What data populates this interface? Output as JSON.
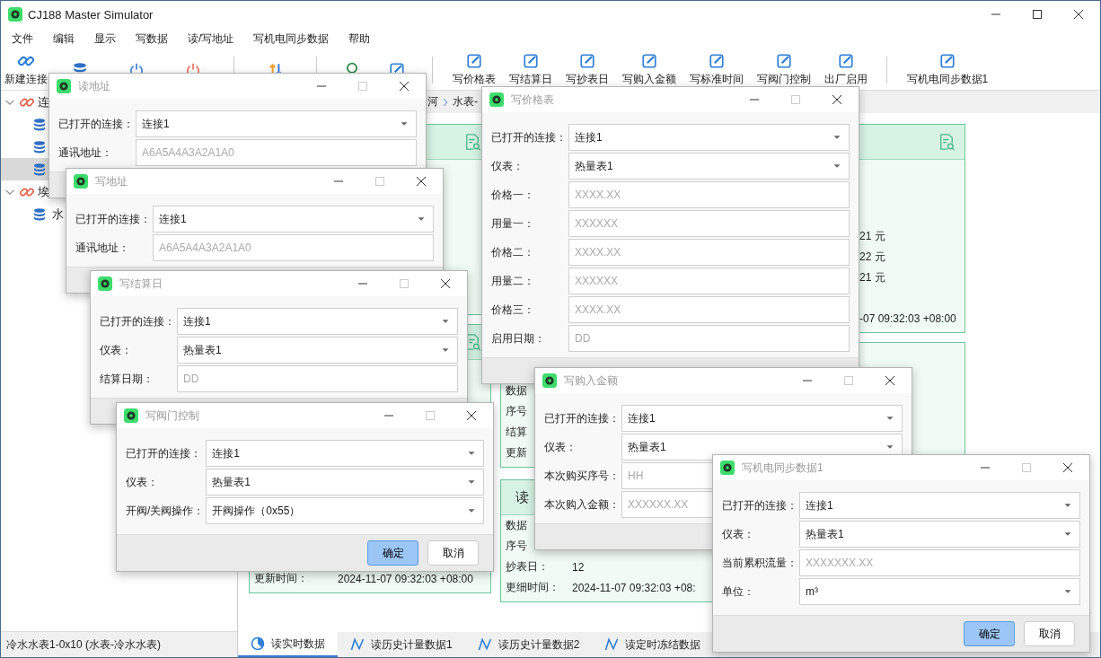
{
  "window": {
    "title": "CJ188 Master Simulator"
  },
  "menu": [
    "文件",
    "编辑",
    "显示",
    "写数据",
    "读/写地址",
    "写机电同步数据",
    "帮助"
  ],
  "toolbar": [
    {
      "kind": "button",
      "label": "新建连接"
    },
    {
      "kind": "button"
    },
    {
      "kind": "button"
    },
    {
      "kind": "button"
    },
    {
      "kind": "separator"
    },
    {
      "kind": "button"
    },
    {
      "kind": "separator"
    },
    {
      "kind": "button"
    },
    {
      "kind": "button"
    },
    {
      "kind": "separator"
    },
    {
      "kind": "button",
      "label": "写价格表"
    },
    {
      "kind": "button",
      "label": "写结算日"
    },
    {
      "kind": "button",
      "label": "写抄表日"
    },
    {
      "kind": "button",
      "label": "写购入金额"
    },
    {
      "kind": "button",
      "label": "写标准时间"
    },
    {
      "kind": "button",
      "label": "写阀门控制"
    },
    {
      "kind": "button",
      "label": "出厂启用"
    },
    {
      "kind": "separator"
    },
    {
      "kind": "button",
      "label": "写机电同步数据1"
    }
  ],
  "tree": [
    {
      "label": "连",
      "expanded": true,
      "selected": false,
      "children": [
        {
          "selected": false
        },
        {
          "selected": false
        },
        {
          "selected": true
        }
      ]
    },
    {
      "label": "埃",
      "expanded": true,
      "selected": false,
      "children": [
        {
          "label": "水",
          "selected": false
        }
      ]
    }
  ],
  "breadcrumb": [
    "河",
    "水表-"
  ],
  "columns": [
    {
      "cards": [
        {
          "kind": "header"
        },
        {
          "kind": "header",
          "rows": [
            {
              "label": "更新时间：",
              "value": "2024-11-07 09:32:03 +08:00"
            }
          ]
        }
      ]
    },
    {
      "cards": [
        {
          "kind": "header",
          "rows": [
            {
              "value": "21 元"
            },
            {
              "value": "22 元"
            },
            {
              "value": "21 元"
            },
            {
              "value": "-07 09:32:03 +08:00"
            }
          ]
        },
        {
          "kind": "plain",
          "rows": [
            {
              "label": "数据"
            },
            {
              "label": "序号"
            },
            {
              "label": "结算"
            },
            {
              "label": "更新"
            }
          ]
        },
        {
          "kind": "header",
          "title": "读",
          "rows": [
            {
              "label": "数据"
            },
            {
              "label": "序号"
            },
            {
              "label": "抄表日：",
              "value": "12"
            },
            {
              "label": "更细时间：",
              "value": "2024-11-07 09:32:03 +08:"
            }
          ]
        }
      ]
    }
  ],
  "bottom_tabs": [
    {
      "label": "读实时数据",
      "selected": true
    },
    {
      "label": "读历史计量数据1",
      "selected": false
    },
    {
      "label": "读历史计量数据2",
      "selected": false
    },
    {
      "label": "读定时冻结数据",
      "selected": false
    }
  ],
  "status_bar": "冷水水表1-0x10 (水表-冷水水表)",
  "dialogs": [
    {
      "title": "读地址",
      "fields": [
        {
          "kind": "combo",
          "label": "已打开的连接：",
          "value": "连接1"
        },
        {
          "kind": "input",
          "label": "通讯地址：",
          "placeholder": "A6A5A4A3A2A1A0"
        }
      ]
    },
    {
      "title": "写地址",
      "fields": [
        {
          "kind": "combo",
          "label": "已打开的连接：",
          "value": "连接1"
        },
        {
          "kind": "input",
          "label": "通讯地址：",
          "placeholder": "A6A5A4A3A2A1A0"
        }
      ]
    },
    {
      "title": "写结算日",
      "fields": [
        {
          "kind": "combo",
          "label": "已打开的连接：",
          "value": "连接1"
        },
        {
          "kind": "combo",
          "label": "仪表：",
          "value": "热量表1"
        },
        {
          "kind": "input",
          "label": "结算日期：",
          "placeholder": "DD"
        }
      ]
    },
    {
      "title": "写阀门控制",
      "fields": [
        {
          "kind": "combo",
          "label": "已打开的连接：",
          "value": "连接1"
        },
        {
          "kind": "combo",
          "label": "仪表：",
          "value": "热量表1"
        },
        {
          "kind": "combo",
          "label": "开阀/关阀操作：",
          "value": "开阀操作（0x55）"
        }
      ],
      "buttons": [
        {
          "label": "确定",
          "focused": true
        },
        {
          "label": "取消",
          "focused": false
        }
      ]
    },
    {
      "title": "写价格表",
      "fields": [
        {
          "kind": "combo",
          "label": "已打开的连接：",
          "value": "连接1"
        },
        {
          "kind": "combo",
          "label": "仪表：",
          "value": "热量表1"
        },
        {
          "kind": "input",
          "label": "价格一：",
          "placeholder": "XXXX.XX"
        },
        {
          "kind": "input",
          "label": "用量一：",
          "placeholder": "XXXXXX"
        },
        {
          "kind": "input",
          "label": "价格二：",
          "placeholder": "XXXX.XX"
        },
        {
          "kind": "input",
          "label": "用量二：",
          "placeholder": "XXXXXX"
        },
        {
          "kind": "input",
          "label": "价格三：",
          "placeholder": "XXXX.XX"
        },
        {
          "kind": "input",
          "label": "启用日期：",
          "placeholder": "DD"
        }
      ]
    },
    {
      "title": "写购入金额",
      "fields": [
        {
          "kind": "combo",
          "label": "已打开的连接：",
          "value": "连接1"
        },
        {
          "kind": "combo",
          "label": "仪表：",
          "value": "热量表1"
        },
        {
          "kind": "input",
          "label": "本次购买序号：",
          "placeholder": "HH"
        },
        {
          "kind": "input",
          "label": "本次购入金额：",
          "placeholder": "XXXXXX.XX"
        }
      ]
    },
    {
      "title": "写机电同步数据1",
      "fields": [
        {
          "kind": "combo",
          "label": "已打开的连接：",
          "value": "连接1"
        },
        {
          "kind": "combo",
          "label": "仪表：",
          "value": "热量表1"
        },
        {
          "kind": "input",
          "label": "当前累积流量：",
          "placeholder": "XXXXXXX.XX"
        },
        {
          "kind": "combo",
          "label": "单位：",
          "value": "m³"
        }
      ],
      "buttons": [
        {
          "label": "确定",
          "focused": true
        },
        {
          "label": "取消",
          "focused": false
        }
      ]
    }
  ]
}
